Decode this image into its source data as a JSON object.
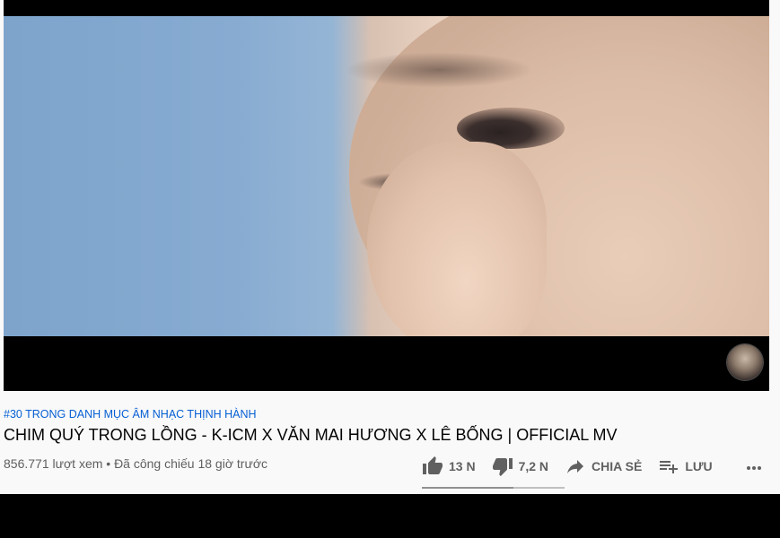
{
  "video": {
    "hashtag": "#30 TRONG DANH MỤC ÂM NHẠC THỊNH HÀNH",
    "title": "CHIM QUÝ TRONG LỒNG - K-ICM X VĂN MAI HƯƠNG X LÊ BỐNG | OFFICIAL MV",
    "views_date": "856.771 lượt xem • Đã công chiếu 18 giờ trước"
  },
  "actions": {
    "like_count": "13 N",
    "dislike_count": "7,2 N",
    "share_label": "CHIA SẺ",
    "save_label": "LƯU",
    "like_ratio": 0.64
  },
  "icons": {
    "like": "thumbs-up-icon",
    "dislike": "thumbs-down-icon",
    "share": "share-arrow-icon",
    "save": "playlist-add-icon",
    "more": "more-horizontal-icon"
  },
  "colors": {
    "hashtag": "#065fd4",
    "title": "#030303",
    "secondary_text": "#606060"
  }
}
